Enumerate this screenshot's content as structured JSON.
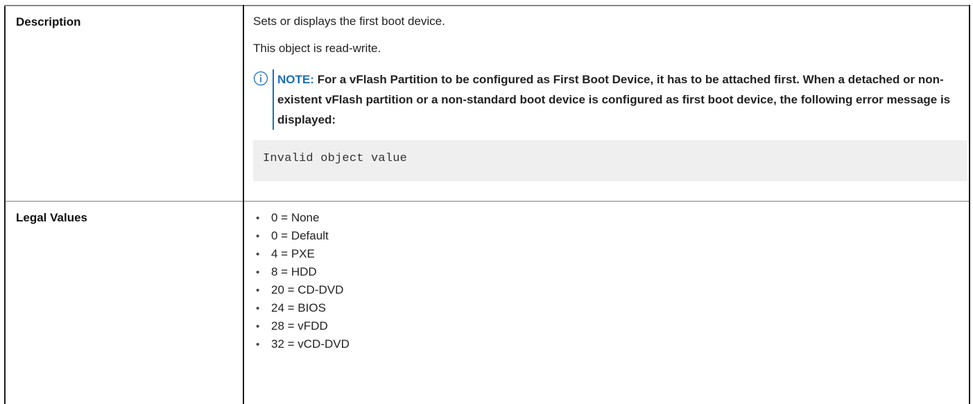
{
  "rows": {
    "description": {
      "label": "Description",
      "paragraphs": [
        "Sets or displays the first boot device.",
        "This object is read-write."
      ],
      "note": {
        "label": "NOTE:",
        "text": " For a vFlash Partition to be configured as First Boot Device, it has to be attached first. When a detached or non-existent vFlash partition or a non-standard boot device is configured as first boot device, the following error message is displayed:",
        "icon": "info-icon"
      },
      "code": "Invalid object value"
    },
    "legal_values": {
      "label": "Legal Values",
      "items": [
        "0 = None",
        "0 = Default",
        "4 = PXE",
        "8 = HDD",
        "20 = CD-DVD",
        "24 = BIOS",
        "28 = vFDD",
        "32 = vCD-DVD"
      ]
    }
  },
  "colors": {
    "note_accent": "#1b6fb8",
    "code_background": "#efefef",
    "border": "#1a1a1a"
  }
}
